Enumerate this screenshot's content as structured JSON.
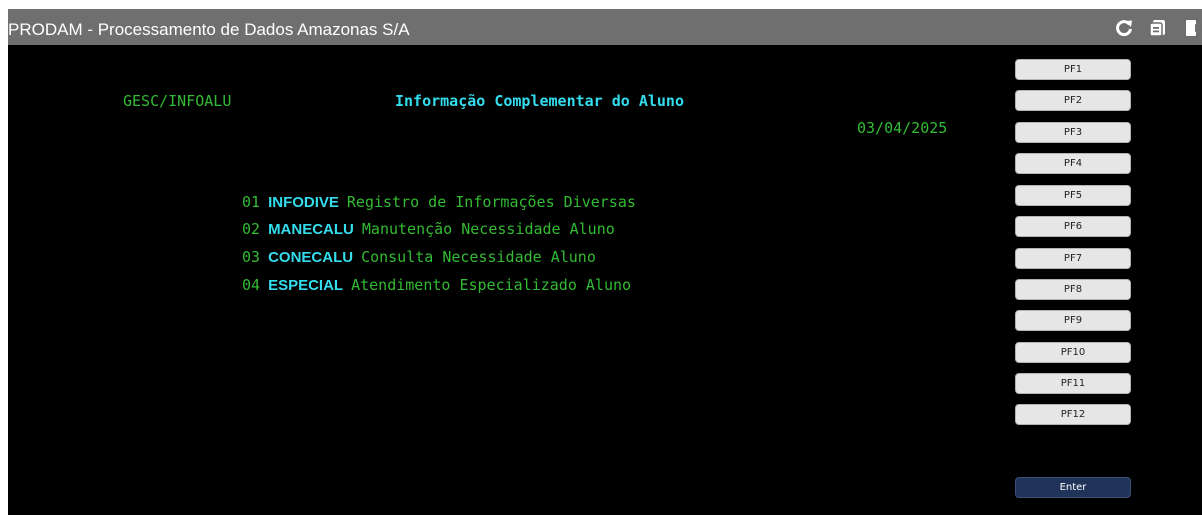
{
  "app": {
    "title": "PRODAM - Processamento de Dados Amazonas S/A",
    "toolbar_icons": [
      "refresh-icon",
      "copy-icon",
      "exit-icon"
    ]
  },
  "screen": {
    "transaction": "GESC/INFOALU",
    "heading": "Informação Complementar do Aluno",
    "date": "03/04/2025",
    "menu": [
      {
        "num": "01",
        "program": "INFODIVE",
        "desc": "Registro de Informações Diversas"
      },
      {
        "num": "02",
        "program": "MANECALU",
        "desc": "Manutenção Necessidade Aluno"
      },
      {
        "num": "03",
        "program": "CONECALU",
        "desc": "Consulta Necessidade Aluno"
      },
      {
        "num": "04",
        "program": "ESPECIAL",
        "desc": "Atendimento Especializado Aluno"
      }
    ]
  },
  "keys": {
    "pf": [
      "PF1",
      "PF2",
      "PF3",
      "PF4",
      "PF5",
      "PF6",
      "PF7",
      "PF8",
      "PF9",
      "PF10",
      "PF11",
      "PF12"
    ],
    "enter": "Enter"
  },
  "colors": {
    "screen_background": "#000000",
    "field_green": "#33bb33",
    "highlight_cyan": "#33ddee",
    "titlebar": "#6f6f6f",
    "enter_button": "#20345a"
  }
}
